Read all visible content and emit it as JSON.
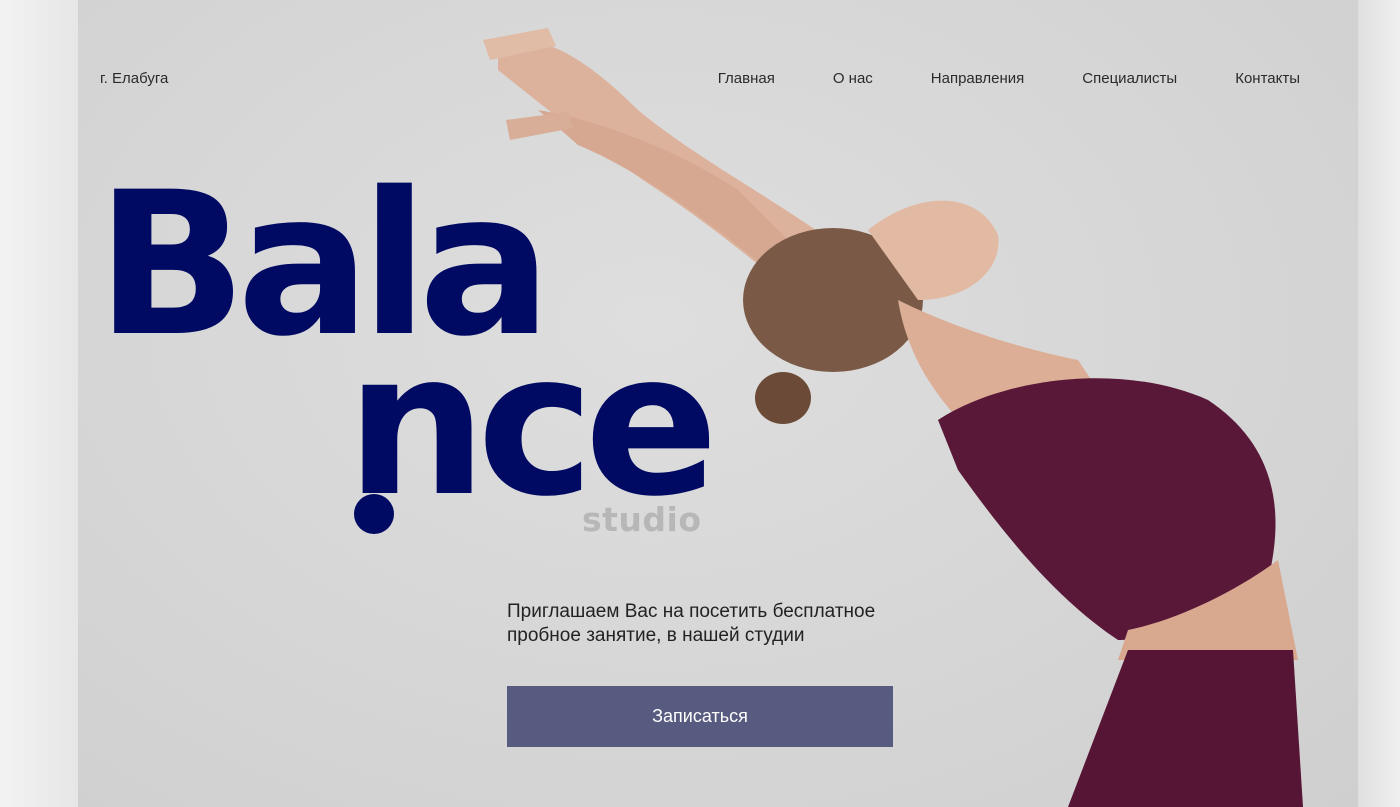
{
  "header": {
    "city": "г. Елабуга",
    "nav": [
      {
        "label": "Главная"
      },
      {
        "label": "О нас"
      },
      {
        "label": "Направления"
      },
      {
        "label": "Специалисты"
      },
      {
        "label": "Контакты"
      }
    ]
  },
  "hero": {
    "brand_line1": "Bala",
    "brand_line2": "nce",
    "brand_sub": "studio",
    "invite_text": "Приглашаем Вас на посетить бесплатное пробное занятие, в нашей студии",
    "cta_label": "Записаться"
  },
  "colors": {
    "brand": "#000a62",
    "button": "#585b80",
    "outfit": "#5a1838"
  },
  "images": {
    "hero_photo": "woman-yoga-backbend-photo"
  }
}
